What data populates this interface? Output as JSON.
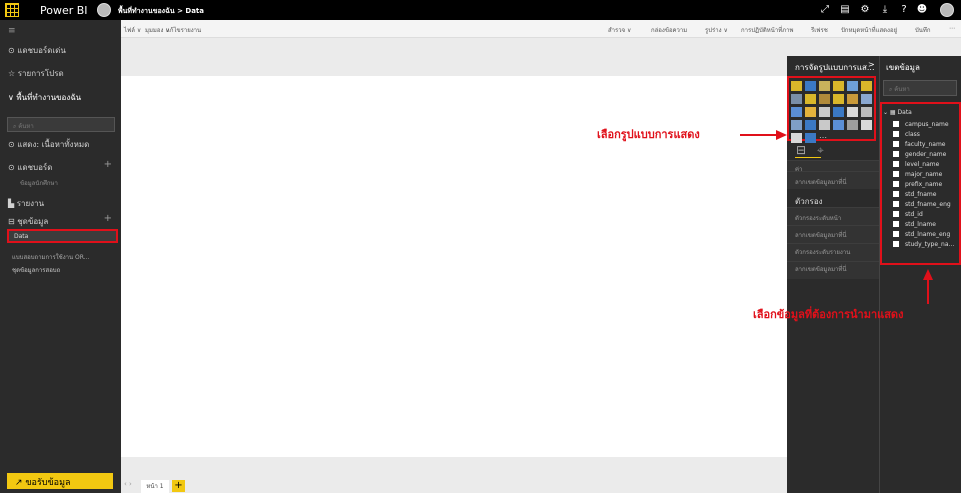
{
  "app": {
    "title": "Power BI"
  },
  "breadcrumb": "พื้นที่ทำงานของฉัน > Data",
  "sidebar": {
    "items": [
      {
        "label": "แดชบอร์ดเด่น"
      },
      {
        "label": "รายการโปรด"
      },
      {
        "label": "พื้นที่ทำงานของฉัน"
      },
      {
        "label": "แสดง: เนื้อหาทั้งหมด"
      },
      {
        "label": "แดชบอร์ด"
      },
      {
        "label": "รายงาน"
      },
      {
        "label": "ชุดข้อมูล"
      }
    ],
    "search_placeholder": "ค้นหา",
    "dash_sub": "ข้อมูลนักศึกษา",
    "dataset_items": [
      "Data",
      "แบบสอบถามการใช้งาน OR...",
      "ชุดข้อมูลการสอบถ"
    ],
    "get_data": "↗ ขอรับข้อมูล"
  },
  "toolbar": {
    "left": [
      "ไฟล์ ∨",
      "มุมมอง ∨",
      "แก้ไขรายงาน"
    ],
    "right": [
      "สำรวจ ∨",
      "กล่องข้อความ",
      "รูปร่าง ∨",
      "การปฏิบัติหน้าที่ภาพ",
      "รีเฟรช",
      "ปักหมุดหน้าที่แสดงอยู่",
      "บันทึก",
      "⋯"
    ]
  },
  "viz_pane": {
    "title": "การจัดรูปแบบการแส...",
    "chevron": ">",
    "values_label": "ค่า",
    "values_hint": "ลากเขตข้อมูลมาที่นี่",
    "filters_title": "ตัวกรอง",
    "filters": [
      "ตัวกรองระดับหน้า",
      "ลากเขตข้อมูลมาที่นี่",
      "ตัวกรองระดับรายงาน",
      "ลากเขตข้อมูลมาที่นี่"
    ]
  },
  "fields_pane": {
    "title": "เขตข้อมูล",
    "search_placeholder": "ค้นหา",
    "table_name": "Data",
    "fields": [
      "campus_name",
      "class",
      "faculty_name",
      "gender_name",
      "level_name",
      "major_name",
      "prefix_name",
      "std_fname",
      "std_fname_eng",
      "std_id",
      "std_lname",
      "std_lname_eng",
      "study_type_na..."
    ]
  },
  "pages": {
    "tab": "หน้า 1",
    "add": "+"
  },
  "annotations": {
    "viz": "เลือกรูปแบบการแสดง",
    "fields": "เลือกข้อมูลที่ต้องการนำมาแสดง"
  }
}
